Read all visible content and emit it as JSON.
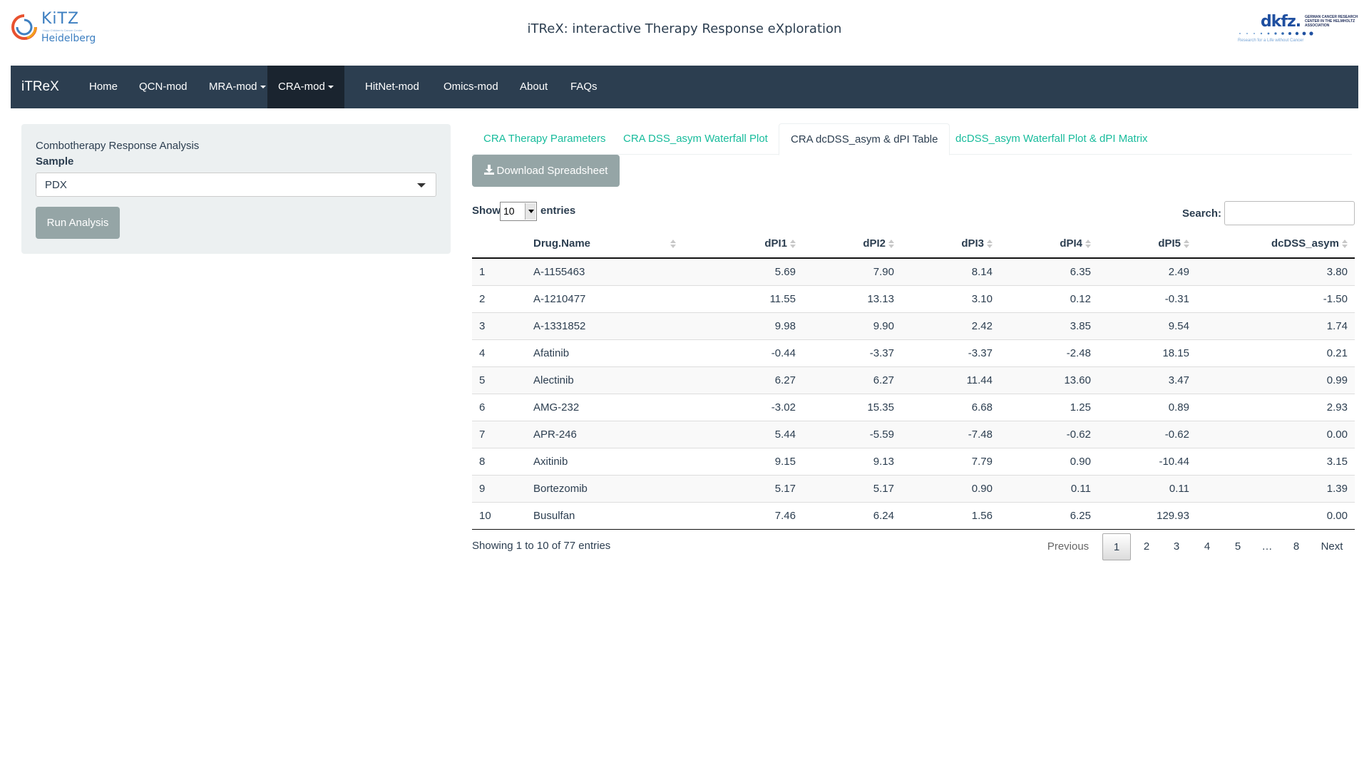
{
  "header": {
    "title": "iTReX: interactive Therapy Response eXploration",
    "left_logo": {
      "name": "KiTZ",
      "city": "Heidelberg",
      "sub": "Hopp Children's Cancer Center"
    },
    "right_logo": {
      "word": "dkfz.",
      "side": "GERMAN CANCER RESEARCH CENTER IN THE HELMHOLTZ ASSOCIATION",
      "tagline": "Research for a Life without Cancer"
    }
  },
  "navbar": {
    "brand": "iTReX",
    "items": [
      {
        "label": "Home"
      },
      {
        "label": "QCN-mod"
      },
      {
        "label": "MRA-mod"
      },
      {
        "label": "CRA-mod"
      },
      {
        "label": "HitNet-mod"
      },
      {
        "label": "Omics-mod"
      },
      {
        "label": "About"
      },
      {
        "label": "FAQs"
      }
    ]
  },
  "sidebar": {
    "title": "Combotherapy Response Analysis",
    "sample_label": "Sample",
    "sample_value": "PDX",
    "run_label": "Run Analysis"
  },
  "tabs": [
    {
      "label": "CRA Therapy Parameters"
    },
    {
      "label": "CRA DSS_asym Waterfall Plot"
    },
    {
      "label": "CRA dcDSS_asym & dPI Table"
    },
    {
      "label": "dcDSS_asym Waterfall Plot & dPI Matrix"
    }
  ],
  "download_label": "Download Spreadsheet",
  "length": {
    "show": "Show",
    "value": "10",
    "entries": "entries"
  },
  "search": {
    "label": "Search:",
    "value": ""
  },
  "table": {
    "columns": [
      "Drug.Name",
      "dPI1",
      "dPI2",
      "dPI3",
      "dPI4",
      "dPI5",
      "dcDSS_asym"
    ],
    "rows": [
      [
        "1",
        "A-1155463",
        "5.69",
        "7.90",
        "8.14",
        "6.35",
        "2.49",
        "3.80"
      ],
      [
        "2",
        "A-1210477",
        "11.55",
        "13.13",
        "3.10",
        "0.12",
        "-0.31",
        "-1.50"
      ],
      [
        "3",
        "A-1331852",
        "9.98",
        "9.90",
        "2.42",
        "3.85",
        "9.54",
        "1.74"
      ],
      [
        "4",
        "Afatinib",
        "-0.44",
        "-3.37",
        "-3.37",
        "-2.48",
        "18.15",
        "0.21"
      ],
      [
        "5",
        "Alectinib",
        "6.27",
        "6.27",
        "11.44",
        "13.60",
        "3.47",
        "0.99"
      ],
      [
        "6",
        "AMG-232",
        "-3.02",
        "15.35",
        "6.68",
        "1.25",
        "0.89",
        "2.93"
      ],
      [
        "7",
        "APR-246",
        "5.44",
        "-5.59",
        "-7.48",
        "-0.62",
        "-0.62",
        "0.00"
      ],
      [
        "8",
        "Axitinib",
        "9.15",
        "9.13",
        "7.79",
        "0.90",
        "-10.44",
        "3.15"
      ],
      [
        "9",
        "Bortezomib",
        "5.17",
        "5.17",
        "0.90",
        "0.11",
        "0.11",
        "1.39"
      ],
      [
        "10",
        "Busulfan",
        "7.46",
        "6.24",
        "1.56",
        "6.25",
        "129.93",
        "0.00"
      ]
    ]
  },
  "info": "Showing 1 to 10 of 77 entries",
  "pagination": {
    "previous": "Previous",
    "pages": [
      "1",
      "2",
      "3",
      "4",
      "5",
      "…",
      "8"
    ],
    "next": "Next"
  },
  "colors": {
    "navbar": "#2c3e50",
    "accent": "#18bc9c",
    "button": "#95a5a6",
    "panel": "#ecf0f1"
  }
}
